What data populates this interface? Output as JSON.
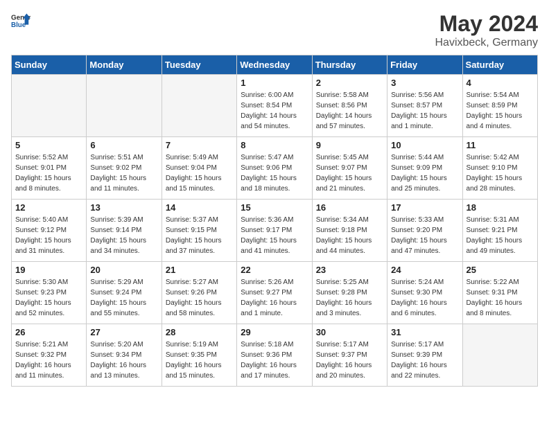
{
  "logo": {
    "text_general": "General",
    "text_blue": "Blue"
  },
  "title": "May 2024",
  "subtitle": "Havixbeck, Germany",
  "days_of_week": [
    "Sunday",
    "Monday",
    "Tuesday",
    "Wednesday",
    "Thursday",
    "Friday",
    "Saturday"
  ],
  "weeks": [
    [
      {
        "day": "",
        "empty": true
      },
      {
        "day": "",
        "empty": true
      },
      {
        "day": "",
        "empty": true
      },
      {
        "day": "1",
        "sunrise": "Sunrise: 6:00 AM",
        "sunset": "Sunset: 8:54 PM",
        "daylight": "Daylight: 14 hours and 54 minutes."
      },
      {
        "day": "2",
        "sunrise": "Sunrise: 5:58 AM",
        "sunset": "Sunset: 8:56 PM",
        "daylight": "Daylight: 14 hours and 57 minutes."
      },
      {
        "day": "3",
        "sunrise": "Sunrise: 5:56 AM",
        "sunset": "Sunset: 8:57 PM",
        "daylight": "Daylight: 15 hours and 1 minute."
      },
      {
        "day": "4",
        "sunrise": "Sunrise: 5:54 AM",
        "sunset": "Sunset: 8:59 PM",
        "daylight": "Daylight: 15 hours and 4 minutes."
      }
    ],
    [
      {
        "day": "5",
        "sunrise": "Sunrise: 5:52 AM",
        "sunset": "Sunset: 9:01 PM",
        "daylight": "Daylight: 15 hours and 8 minutes."
      },
      {
        "day": "6",
        "sunrise": "Sunrise: 5:51 AM",
        "sunset": "Sunset: 9:02 PM",
        "daylight": "Daylight: 15 hours and 11 minutes."
      },
      {
        "day": "7",
        "sunrise": "Sunrise: 5:49 AM",
        "sunset": "Sunset: 9:04 PM",
        "daylight": "Daylight: 15 hours and 15 minutes."
      },
      {
        "day": "8",
        "sunrise": "Sunrise: 5:47 AM",
        "sunset": "Sunset: 9:06 PM",
        "daylight": "Daylight: 15 hours and 18 minutes."
      },
      {
        "day": "9",
        "sunrise": "Sunrise: 5:45 AM",
        "sunset": "Sunset: 9:07 PM",
        "daylight": "Daylight: 15 hours and 21 minutes."
      },
      {
        "day": "10",
        "sunrise": "Sunrise: 5:44 AM",
        "sunset": "Sunset: 9:09 PM",
        "daylight": "Daylight: 15 hours and 25 minutes."
      },
      {
        "day": "11",
        "sunrise": "Sunrise: 5:42 AM",
        "sunset": "Sunset: 9:10 PM",
        "daylight": "Daylight: 15 hours and 28 minutes."
      }
    ],
    [
      {
        "day": "12",
        "sunrise": "Sunrise: 5:40 AM",
        "sunset": "Sunset: 9:12 PM",
        "daylight": "Daylight: 15 hours and 31 minutes."
      },
      {
        "day": "13",
        "sunrise": "Sunrise: 5:39 AM",
        "sunset": "Sunset: 9:14 PM",
        "daylight": "Daylight: 15 hours and 34 minutes."
      },
      {
        "day": "14",
        "sunrise": "Sunrise: 5:37 AM",
        "sunset": "Sunset: 9:15 PM",
        "daylight": "Daylight: 15 hours and 37 minutes."
      },
      {
        "day": "15",
        "sunrise": "Sunrise: 5:36 AM",
        "sunset": "Sunset: 9:17 PM",
        "daylight": "Daylight: 15 hours and 41 minutes."
      },
      {
        "day": "16",
        "sunrise": "Sunrise: 5:34 AM",
        "sunset": "Sunset: 9:18 PM",
        "daylight": "Daylight: 15 hours and 44 minutes."
      },
      {
        "day": "17",
        "sunrise": "Sunrise: 5:33 AM",
        "sunset": "Sunset: 9:20 PM",
        "daylight": "Daylight: 15 hours and 47 minutes."
      },
      {
        "day": "18",
        "sunrise": "Sunrise: 5:31 AM",
        "sunset": "Sunset: 9:21 PM",
        "daylight": "Daylight: 15 hours and 49 minutes."
      }
    ],
    [
      {
        "day": "19",
        "sunrise": "Sunrise: 5:30 AM",
        "sunset": "Sunset: 9:23 PM",
        "daylight": "Daylight: 15 hours and 52 minutes."
      },
      {
        "day": "20",
        "sunrise": "Sunrise: 5:29 AM",
        "sunset": "Sunset: 9:24 PM",
        "daylight": "Daylight: 15 hours and 55 minutes."
      },
      {
        "day": "21",
        "sunrise": "Sunrise: 5:27 AM",
        "sunset": "Sunset: 9:26 PM",
        "daylight": "Daylight: 15 hours and 58 minutes."
      },
      {
        "day": "22",
        "sunrise": "Sunrise: 5:26 AM",
        "sunset": "Sunset: 9:27 PM",
        "daylight": "Daylight: 16 hours and 1 minute."
      },
      {
        "day": "23",
        "sunrise": "Sunrise: 5:25 AM",
        "sunset": "Sunset: 9:28 PM",
        "daylight": "Daylight: 16 hours and 3 minutes."
      },
      {
        "day": "24",
        "sunrise": "Sunrise: 5:24 AM",
        "sunset": "Sunset: 9:30 PM",
        "daylight": "Daylight: 16 hours and 6 minutes."
      },
      {
        "day": "25",
        "sunrise": "Sunrise: 5:22 AM",
        "sunset": "Sunset: 9:31 PM",
        "daylight": "Daylight: 16 hours and 8 minutes."
      }
    ],
    [
      {
        "day": "26",
        "sunrise": "Sunrise: 5:21 AM",
        "sunset": "Sunset: 9:32 PM",
        "daylight": "Daylight: 16 hours and 11 minutes."
      },
      {
        "day": "27",
        "sunrise": "Sunrise: 5:20 AM",
        "sunset": "Sunset: 9:34 PM",
        "daylight": "Daylight: 16 hours and 13 minutes."
      },
      {
        "day": "28",
        "sunrise": "Sunrise: 5:19 AM",
        "sunset": "Sunset: 9:35 PM",
        "daylight": "Daylight: 16 hours and 15 minutes."
      },
      {
        "day": "29",
        "sunrise": "Sunrise: 5:18 AM",
        "sunset": "Sunset: 9:36 PM",
        "daylight": "Daylight: 16 hours and 17 minutes."
      },
      {
        "day": "30",
        "sunrise": "Sunrise: 5:17 AM",
        "sunset": "Sunset: 9:37 PM",
        "daylight": "Daylight: 16 hours and 20 minutes."
      },
      {
        "day": "31",
        "sunrise": "Sunrise: 5:17 AM",
        "sunset": "Sunset: 9:39 PM",
        "daylight": "Daylight: 16 hours and 22 minutes."
      },
      {
        "day": "",
        "empty": true
      }
    ]
  ]
}
